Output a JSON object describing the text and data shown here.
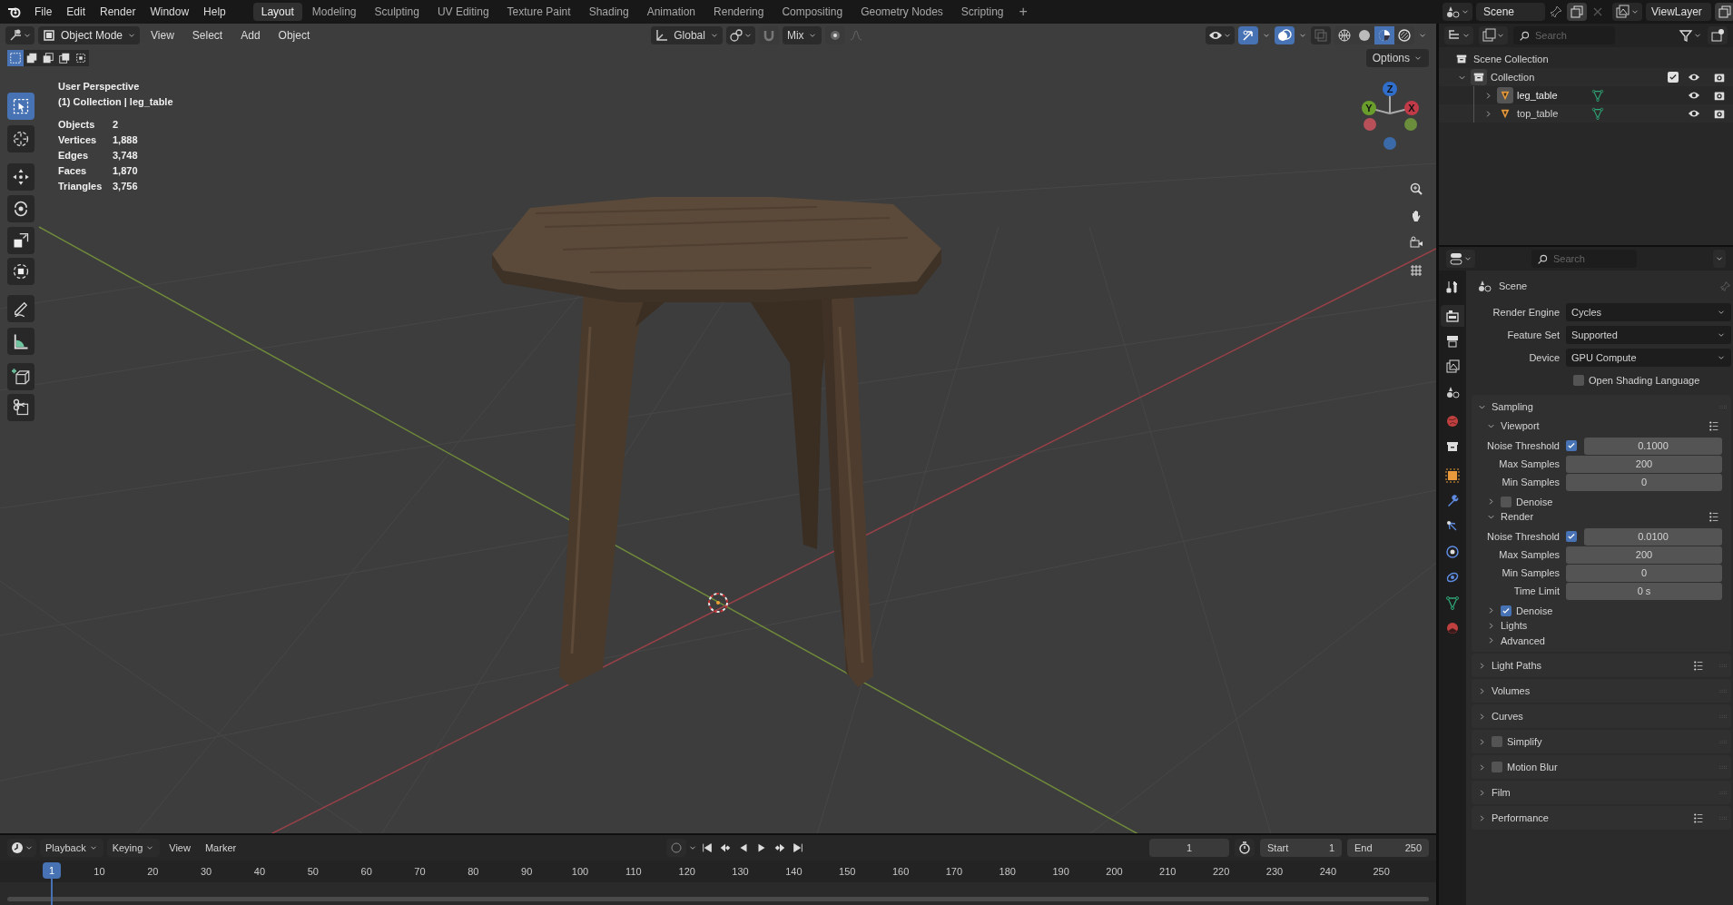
{
  "top_menu": [
    "File",
    "Edit",
    "Render",
    "Window",
    "Help"
  ],
  "workspaces": [
    {
      "label": "Layout",
      "selected": true
    },
    {
      "label": "Modeling",
      "selected": false
    },
    {
      "label": "Sculpting",
      "selected": false
    },
    {
      "label": "UV Editing",
      "selected": false
    },
    {
      "label": "Texture Paint",
      "selected": false
    },
    {
      "label": "Shading",
      "selected": false
    },
    {
      "label": "Animation",
      "selected": false
    },
    {
      "label": "Rendering",
      "selected": false
    },
    {
      "label": "Compositing",
      "selected": false
    },
    {
      "label": "Geometry Nodes",
      "selected": false
    },
    {
      "label": "Scripting",
      "selected": false
    }
  ],
  "add_workspace": "+",
  "scene": "Scene",
  "view_layer": "ViewLayer",
  "viewport_header": {
    "mode": "Object Mode",
    "menus": [
      "View",
      "Select",
      "Add",
      "Object"
    ],
    "orientation": "Global",
    "snap_target": "Mix",
    "options": "Options"
  },
  "select_modes": [
    {
      "selected": true
    },
    {
      "selected": false
    },
    {
      "selected": false
    },
    {
      "selected": false
    },
    {
      "selected": false
    }
  ],
  "shading": [
    {
      "selected": false
    },
    {
      "selected": false
    },
    {
      "selected": true
    },
    {
      "selected": false
    }
  ],
  "overlay": {
    "view": "User Perspective",
    "context": "(1) Collection | leg_table",
    "stats": [
      {
        "label": "Objects",
        "value": "2"
      },
      {
        "label": "Vertices",
        "value": "1,888"
      },
      {
        "label": "Edges",
        "value": "3,748"
      },
      {
        "label": "Faces",
        "value": "1,870"
      },
      {
        "label": "Triangles",
        "value": "3,756"
      }
    ]
  },
  "tools": [
    {
      "selected": true
    },
    {
      "selected": false
    },
    {
      "selected": false
    },
    {
      "selected": false
    },
    {
      "selected": false
    },
    {
      "selected": false
    },
    {
      "selected": false
    },
    {
      "selected": false
    },
    {
      "selected": false
    },
    {
      "selected": false
    }
  ],
  "gizmo_axes": [
    {
      "label": "Z"
    },
    {
      "label": "Y"
    },
    {
      "label": "X"
    }
  ],
  "outliner": {
    "search_placeholder": "Search",
    "root": "Scene Collection",
    "items": [
      {
        "label": "Collection",
        "expanded": true,
        "checked": true,
        "children": [
          {
            "label": "leg_table",
            "selected": true,
            "expanded": false
          },
          {
            "label": "top_table",
            "selected": false,
            "expanded": false
          }
        ]
      }
    ]
  },
  "properties": {
    "search_placeholder": "Search",
    "tabs": [
      {
        "selected": false
      },
      {
        "selected": true
      },
      {
        "selected": false
      },
      {
        "selected": false
      },
      {
        "selected": false
      },
      {
        "selected": false
      },
      {
        "selected": false
      },
      {
        "selected": false
      },
      {
        "selected": false
      },
      {
        "selected": false
      },
      {
        "selected": false
      },
      {
        "selected": false
      },
      {
        "selected": false
      },
      {
        "selected": false
      }
    ],
    "context": "Scene",
    "fields": [
      {
        "label": "Render Engine",
        "value": "Cycles"
      },
      {
        "label": "Feature Set",
        "value": "Supported"
      },
      {
        "label": "Device",
        "value": "GPU Compute"
      }
    ],
    "osl": {
      "label": "Open Shading Language",
      "checked": false
    },
    "panels": [
      {
        "title": "Sampling",
        "kind": "plain",
        "expanded": true,
        "subpanels": [
          {
            "title": "Viewport",
            "kind": "plain",
            "expanded": true,
            "presets": true,
            "rows": [
              {
                "kind": "toggle_number",
                "label": "Noise Threshold",
                "checked": true,
                "value": "0.1000"
              },
              {
                "kind": "number",
                "label": "Max Samples",
                "value": "200"
              },
              {
                "kind": "number",
                "label": "Min Samples",
                "value": "0"
              }
            ]
          },
          {
            "title": "Denoise",
            "kind": "toggle",
            "checked": false,
            "expanded": false
          },
          {
            "title": "Render",
            "kind": "plain",
            "expanded": true,
            "presets": true,
            "rows": [
              {
                "kind": "toggle_number",
                "label": "Noise Threshold",
                "checked": true,
                "value": "0.0100"
              },
              {
                "kind": "number",
                "label": "Max Samples",
                "value": "200"
              },
              {
                "kind": "number",
                "label": "Min Samples",
                "value": "0"
              },
              {
                "kind": "number",
                "label": "Time Limit",
                "value": "0 s"
              }
            ]
          },
          {
            "title": "Denoise",
            "kind": "toggle",
            "checked": true,
            "expanded": false
          },
          {
            "title": "Lights",
            "kind": "plain",
            "expanded": false
          },
          {
            "title": "Advanced",
            "kind": "plain",
            "expanded": false
          }
        ]
      },
      {
        "title": "Light Paths",
        "kind": "plain",
        "expanded": false,
        "presets": true
      },
      {
        "title": "Volumes",
        "kind": "plain",
        "expanded": false
      },
      {
        "title": "Curves",
        "kind": "plain",
        "expanded": false
      },
      {
        "title": "Simplify",
        "kind": "toggle",
        "checked": false,
        "expanded": false
      },
      {
        "title": "Motion Blur",
        "kind": "toggle",
        "checked": false,
        "expanded": false
      },
      {
        "title": "Film",
        "kind": "plain",
        "expanded": false
      },
      {
        "title": "Performance",
        "kind": "plain",
        "expanded": false,
        "presets": true
      }
    ]
  },
  "timeline": {
    "menus": [
      "Playback",
      "Keying",
      "View",
      "Marker"
    ],
    "current_frame": "1",
    "start_label": "Start",
    "start": "1",
    "end_label": "End",
    "end": "250",
    "playhead": "1",
    "ruler": [
      "10",
      "20",
      "30",
      "40",
      "50",
      "60",
      "70",
      "80",
      "90",
      "100",
      "110",
      "120",
      "130",
      "140",
      "150",
      "160",
      "170",
      "180",
      "190",
      "200",
      "210",
      "220",
      "230",
      "240",
      "250"
    ]
  }
}
